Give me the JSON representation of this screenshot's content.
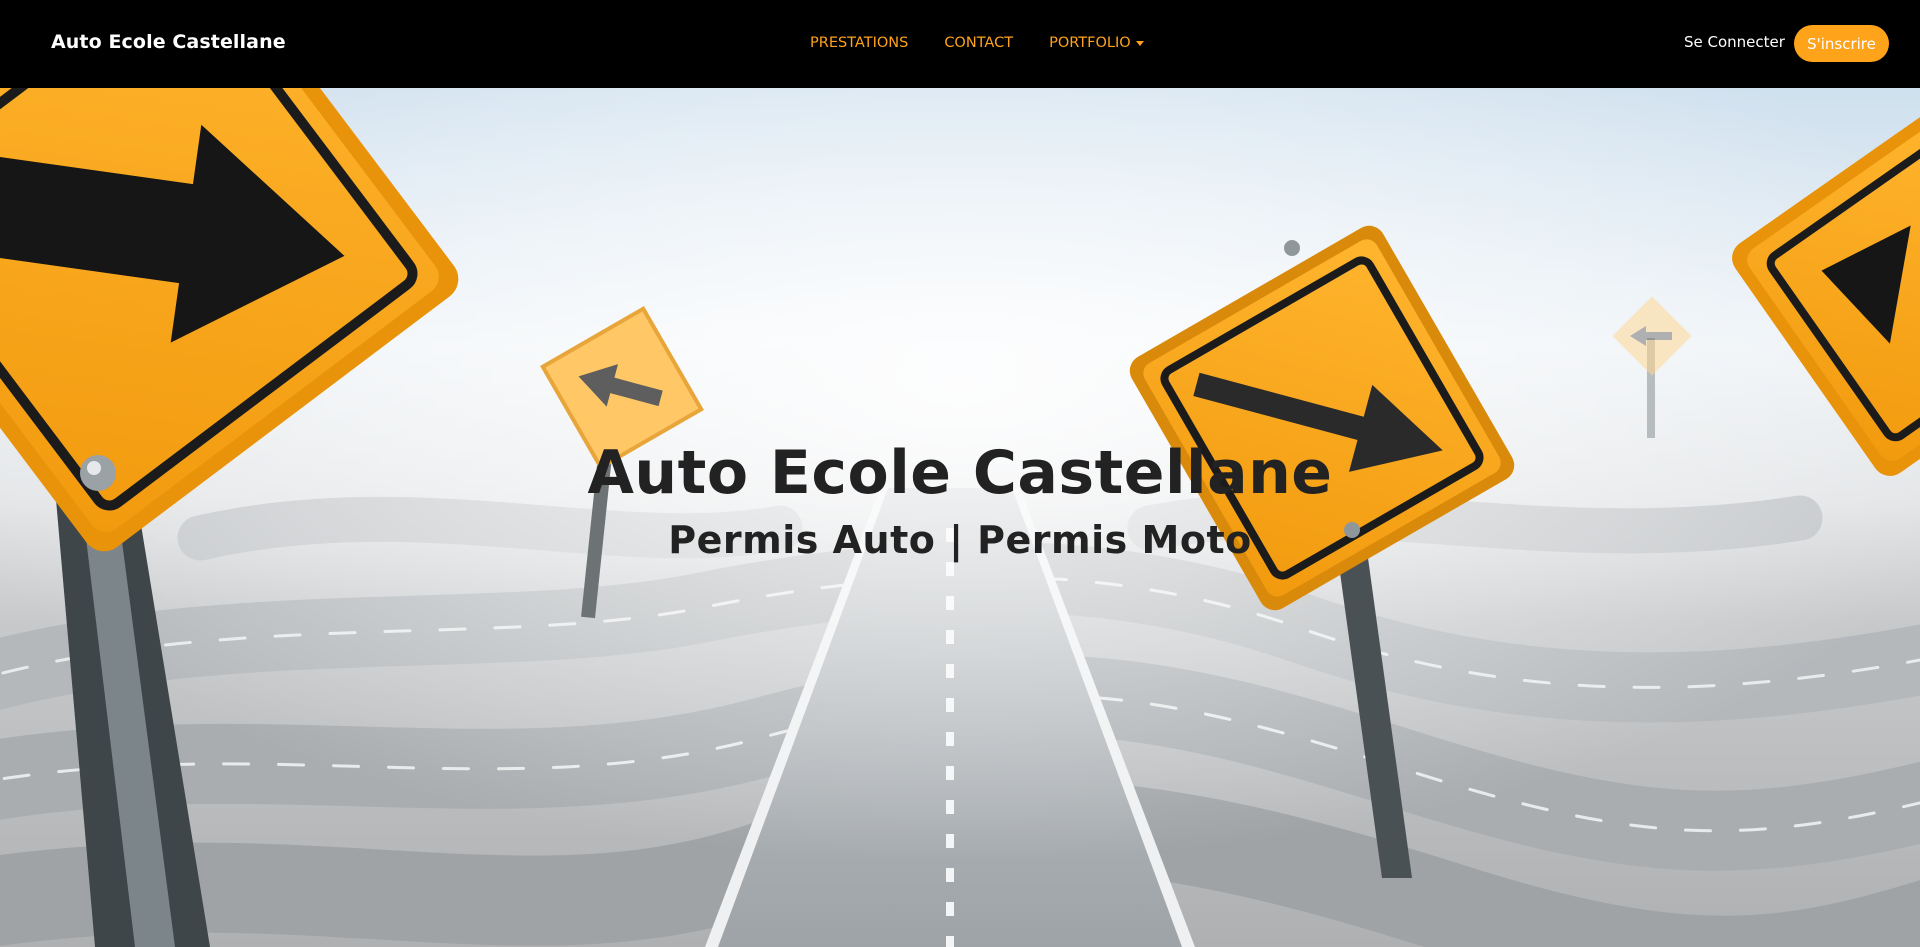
{
  "navbar": {
    "brand": "Auto Ecole Castellane",
    "links": [
      {
        "label": "PRESTATIONS"
      },
      {
        "label": "CONTACT"
      },
      {
        "label": "PORTFOLIO"
      }
    ],
    "login_label": "Se Connecter",
    "signup_label": "S'inscrire"
  },
  "hero": {
    "title": "Auto Ecole Castellane",
    "subtitle": "Permis Auto | Permis Moto",
    "background_icon": "road-signs-illustration"
  },
  "colors": {
    "accent": "#ffa31a",
    "navbar_bg": "#000000",
    "text_dark": "#222222"
  }
}
